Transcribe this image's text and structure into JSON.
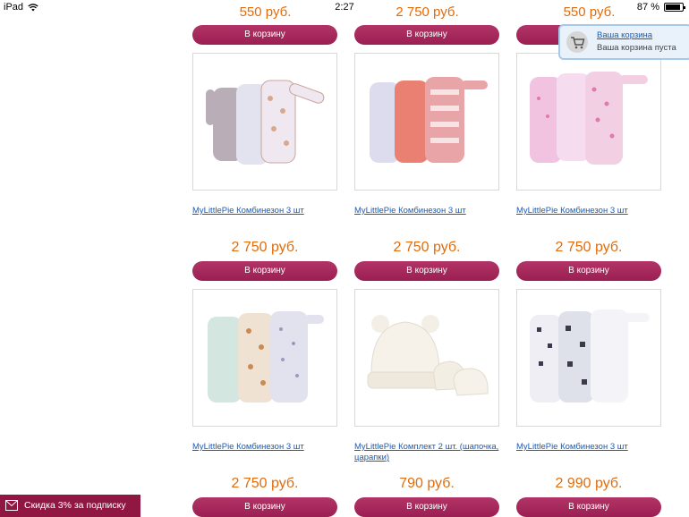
{
  "status_bar": {
    "device": "iPad",
    "time": "2:27",
    "battery": "87 %"
  },
  "cart": {
    "title": "Ваша корзина",
    "status": "Ваша корзина пуста"
  },
  "promo": {
    "label": "Скидка  3% за подписку"
  },
  "top_row": {
    "prices": [
      "550 руб.",
      "2 750 руб.",
      "550 руб."
    ],
    "button_label": "В корзину"
  },
  "products": [
    {
      "title": "MyLittlePie Комбинезон 3 шт",
      "price": "2 750 руб.",
      "button": "В корзину"
    },
    {
      "title": "MyLittlePie Комбинезон 3 шт",
      "price": "2 750 руб.",
      "button": "В корзину"
    },
    {
      "title": "MyLittlePie Комбинезон 3 шт",
      "price": "2 750 руб.",
      "button": "В корзину"
    },
    {
      "title": "MyLittlePie Комбинезон 3 шт",
      "price": "2 750 руб.",
      "button": "В корзину"
    },
    {
      "title": "MyLittlePie Комплект 2 шт. (шапочка, царапки)",
      "price": "790 руб.",
      "button": "В корзину"
    },
    {
      "title": "MyLittlePie Комбинезон 3 шт",
      "price": "2 990 руб.",
      "button": "В корзину"
    }
  ]
}
